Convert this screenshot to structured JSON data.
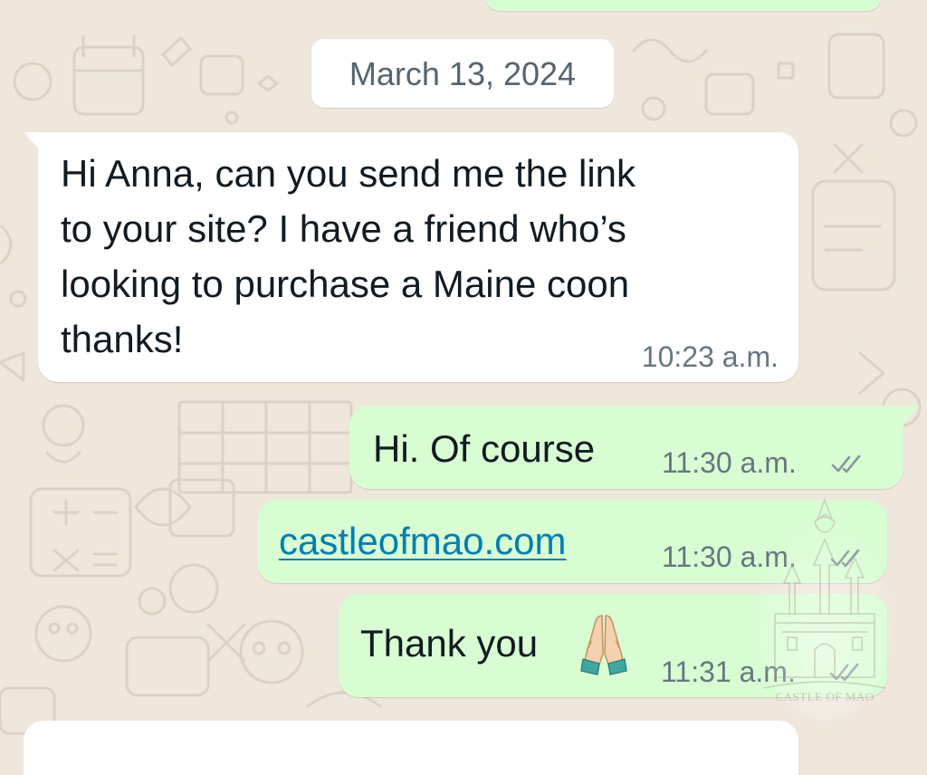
{
  "chat": {
    "date_separator": "March 13, 2024",
    "messages": [
      {
        "direction": "incoming",
        "lines": [
          "Hi Anna, can you send me the link",
          "to your site? I have a friend who’s",
          "looking to purchase a Maine coon",
          "thanks!"
        ],
        "time": "10:23 a.m."
      },
      {
        "direction": "outgoing",
        "text": "Hi. Of course",
        "time": "11:30 a.m.",
        "status_icon": "double-check-read-icon"
      },
      {
        "direction": "outgoing",
        "link_text": "castleofmao.com",
        "time": "11:30 a.m.",
        "status_icon": "double-check-read-icon"
      },
      {
        "direction": "outgoing",
        "text": "Thank you",
        "emoji": "🙏",
        "emoji_icon": "folded-hands-emoji",
        "time": "11:31 a.m.",
        "status_icon": "double-check-read-icon"
      }
    ]
  },
  "watermark": {
    "text": "CASTLE OF MAO",
    "icon": "castle-logo"
  },
  "colors": {
    "background": "#efe7dc",
    "incoming_bubble": "#ffffff",
    "outgoing_bubble": "#d9fdd3",
    "text": "#111b21",
    "meta_text": "#667781",
    "link": "#027eb5",
    "tick": "#8696a0"
  }
}
